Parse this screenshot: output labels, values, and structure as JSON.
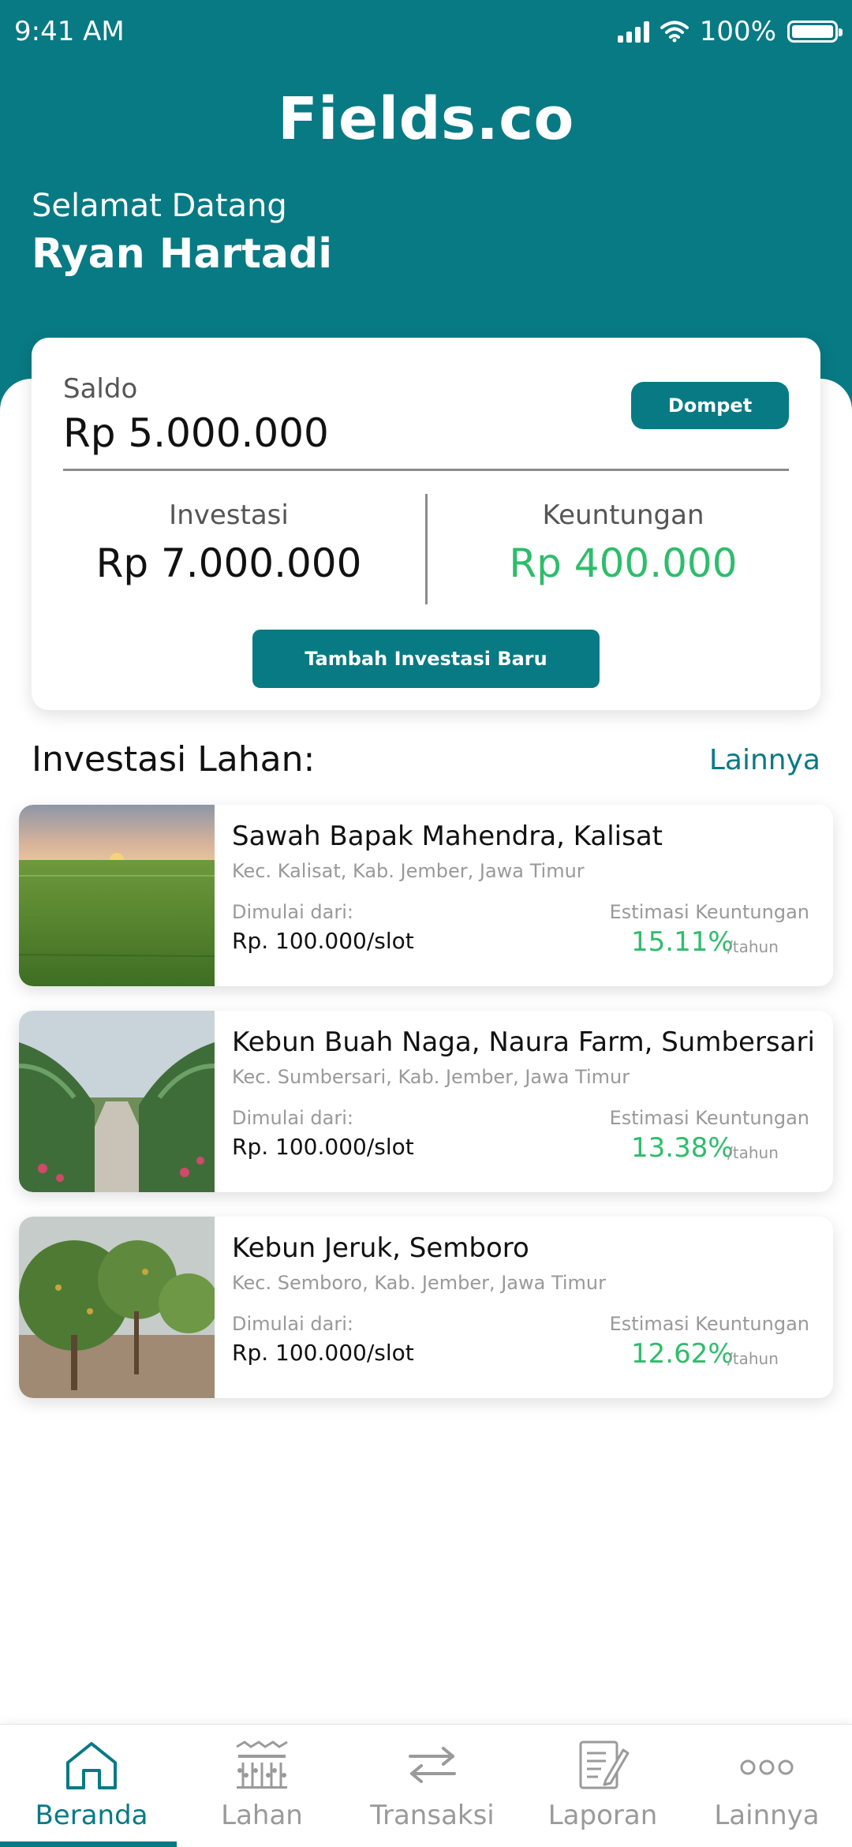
{
  "status_bar": {
    "time": "9:41 AM",
    "battery": "100%"
  },
  "app": {
    "brand": "Fields.co"
  },
  "greeting": {
    "welcome": "Selamat Datang",
    "name": "Ryan Hartadi"
  },
  "summary": {
    "saldo_label": "Saldo",
    "saldo_value": "Rp 5.000.000",
    "wallet_button": "Dompet",
    "investasi_label": "Investasi",
    "investasi_value": "Rp 7.000.000",
    "keuntungan_label": "Keuntungan",
    "keuntungan_value": "Rp 400.000",
    "add_button": "Tambah Investasi Baru"
  },
  "section": {
    "title": "Investasi Lahan:",
    "more": "Lainnya"
  },
  "investments": [
    {
      "title": "Sawah Bapak Mahendra, Kalisat",
      "location": "Kec. Kalisat, Kab. Jember, Jawa Timur",
      "start_label": "Dimulai dari:",
      "price": "Rp. 100.000/slot",
      "est_label": "Estimasi Keuntungan",
      "rate": "15.11%",
      "unit": "/tahun"
    },
    {
      "title": "Kebun Buah Naga, Naura Farm, Sumbersari",
      "location": "Kec. Sumbersari, Kab. Jember, Jawa Timur",
      "start_label": "Dimulai dari:",
      "price": "Rp. 100.000/slot",
      "est_label": "Estimasi Keuntungan",
      "rate": "13.38%",
      "unit": "/tahun"
    },
    {
      "title": "Kebun Jeruk, Semboro",
      "location": "Kec. Semboro, Kab. Jember, Jawa Timur",
      "start_label": "Dimulai dari:",
      "price": "Rp. 100.000/slot",
      "est_label": "Estimasi Keuntungan",
      "rate": "12.62%",
      "unit": "/tahun"
    }
  ],
  "nav": {
    "items": [
      {
        "label": "Beranda",
        "icon": "home-icon",
        "active": true
      },
      {
        "label": "Lahan",
        "icon": "field-icon",
        "active": false
      },
      {
        "label": "Transaksi",
        "icon": "transfer-icon",
        "active": false
      },
      {
        "label": "Laporan",
        "icon": "report-icon",
        "active": false
      },
      {
        "label": "Lainnya",
        "icon": "more-icon",
        "active": false
      }
    ]
  },
  "colors": {
    "primary": "#087A84",
    "positive": "#2EBD6B",
    "muted": "#9A9A9A"
  }
}
